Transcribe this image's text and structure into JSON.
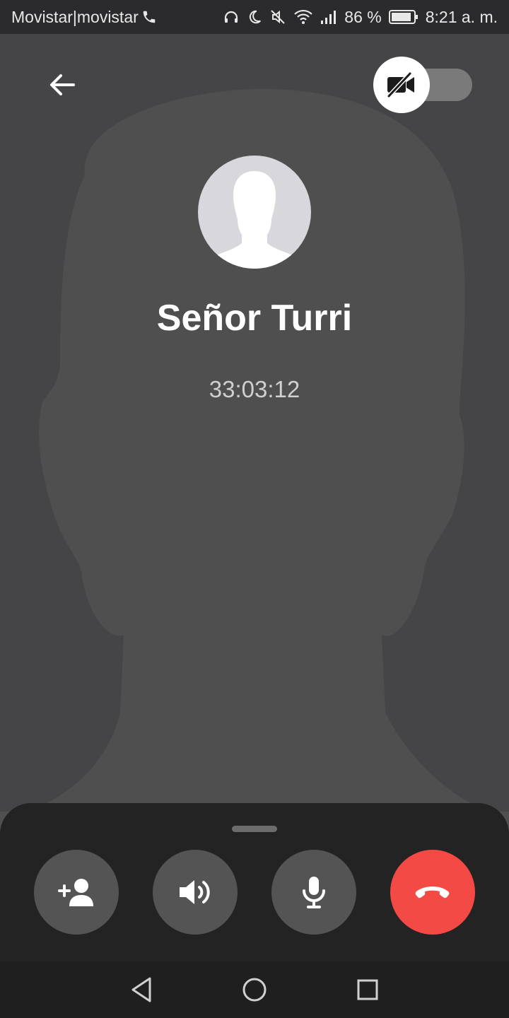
{
  "status_bar": {
    "carrier": "Movistar|movistar",
    "battery": "86 %",
    "time": "8:21 a. m.",
    "icons": [
      "phone-icon",
      "headphones-icon",
      "moon-icon",
      "muted-icon",
      "wifi-icon",
      "signal-icon",
      "battery-icon"
    ]
  },
  "call": {
    "caller_name": "Señor Turri",
    "duration": "33:03:12",
    "video_enabled": false
  },
  "controls": [
    {
      "name": "add-participant",
      "icon": "add-person-icon"
    },
    {
      "name": "speaker",
      "icon": "speaker-icon"
    },
    {
      "name": "mute",
      "icon": "microphone-icon"
    },
    {
      "name": "end-call",
      "icon": "hang-up-icon"
    }
  ],
  "colors": {
    "background": "#454547",
    "end_call": "#f44a45",
    "control_button": "#545455",
    "sheet": "#232323"
  },
  "nav": [
    "back-nav-icon",
    "home-nav-icon",
    "recents-nav-icon"
  ]
}
